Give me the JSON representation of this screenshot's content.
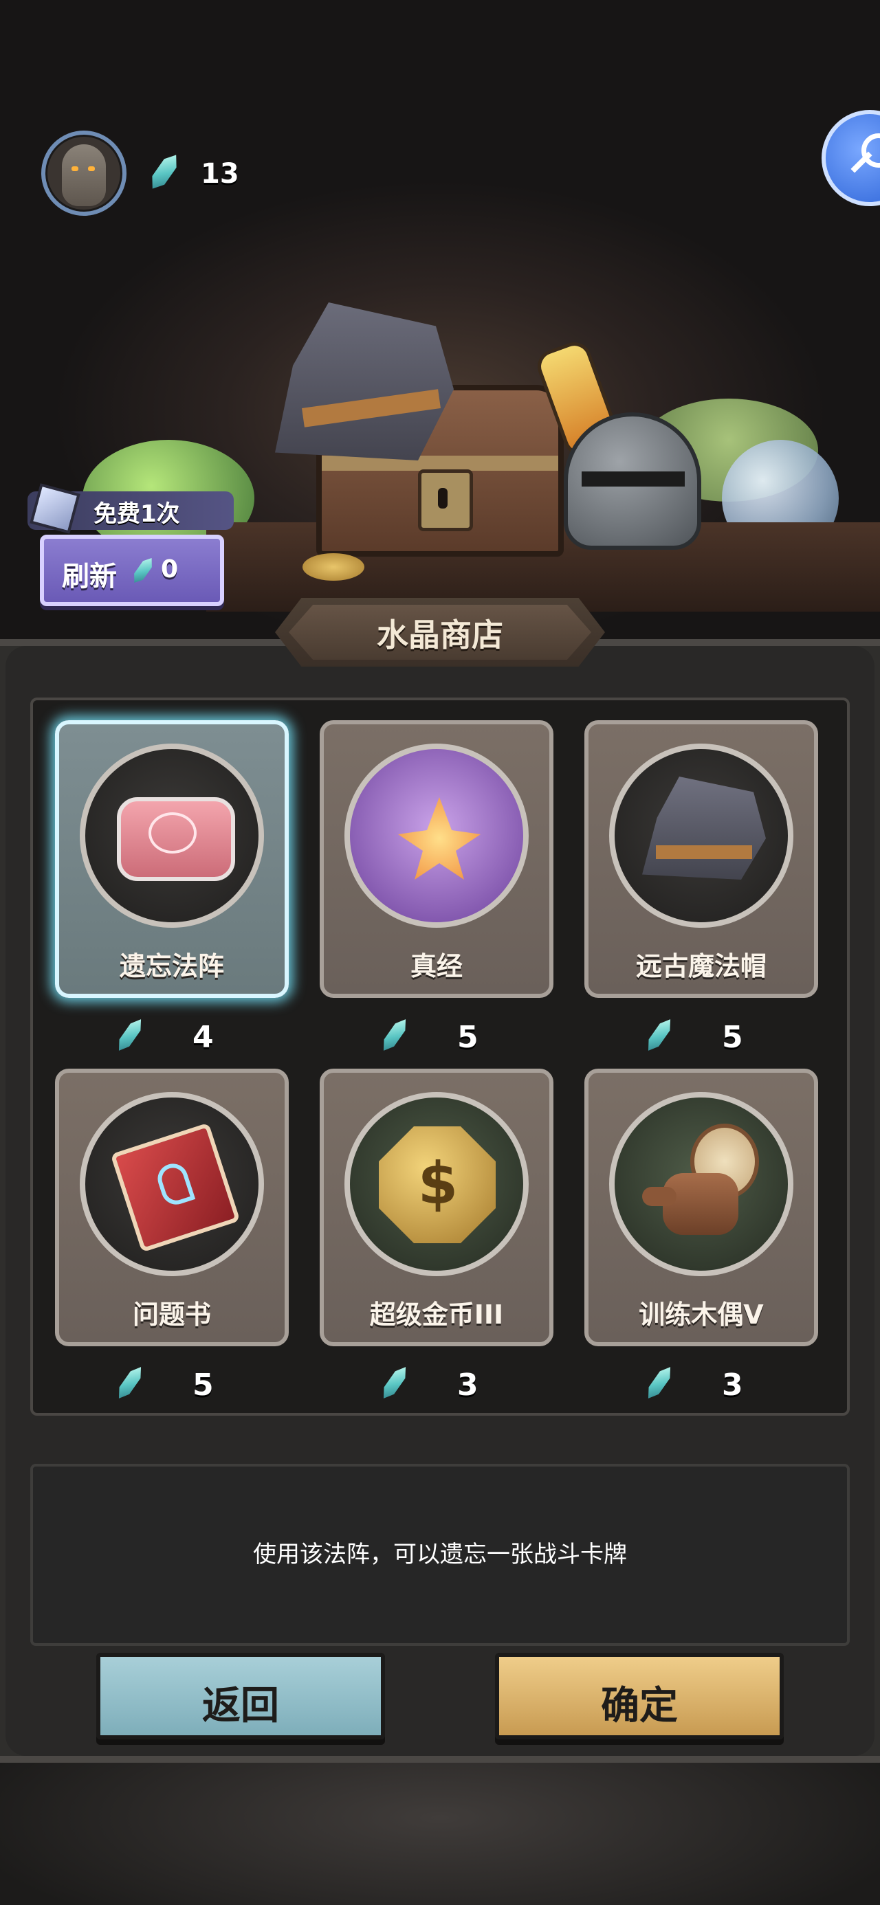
{
  "header": {
    "crystal_count": "13"
  },
  "refresh": {
    "free_label": "免费1次",
    "button_label": "刷新",
    "cost": "0"
  },
  "shop": {
    "title": "水晶商店",
    "items": [
      {
        "name": "遗忘法阵",
        "price": "4",
        "selected": true,
        "icon": "forget-circle-icon"
      },
      {
        "name": "真经",
        "price": "5",
        "selected": false,
        "icon": "lotus-icon"
      },
      {
        "name": "远古魔法帽",
        "price": "5",
        "selected": false,
        "icon": "wizard-hat-icon"
      },
      {
        "name": "问题书",
        "price": "5",
        "selected": false,
        "icon": "question-book-icon"
      },
      {
        "name": "超级金币III",
        "price": "3",
        "selected": false,
        "icon": "gold-coin-icon"
      },
      {
        "name": "训练木偶V",
        "price": "3",
        "selected": false,
        "icon": "training-dummy-icon"
      }
    ],
    "description": "使用该法阵，可以遗忘一张战斗卡牌"
  },
  "buttons": {
    "back_label": "返回",
    "confirm_label": "确定"
  },
  "colors": {
    "selected_glow": "#68c6d9",
    "crystal": "#59c5c3",
    "back_button": "#a8cfd8",
    "confirm_button": "#efcd8a"
  }
}
